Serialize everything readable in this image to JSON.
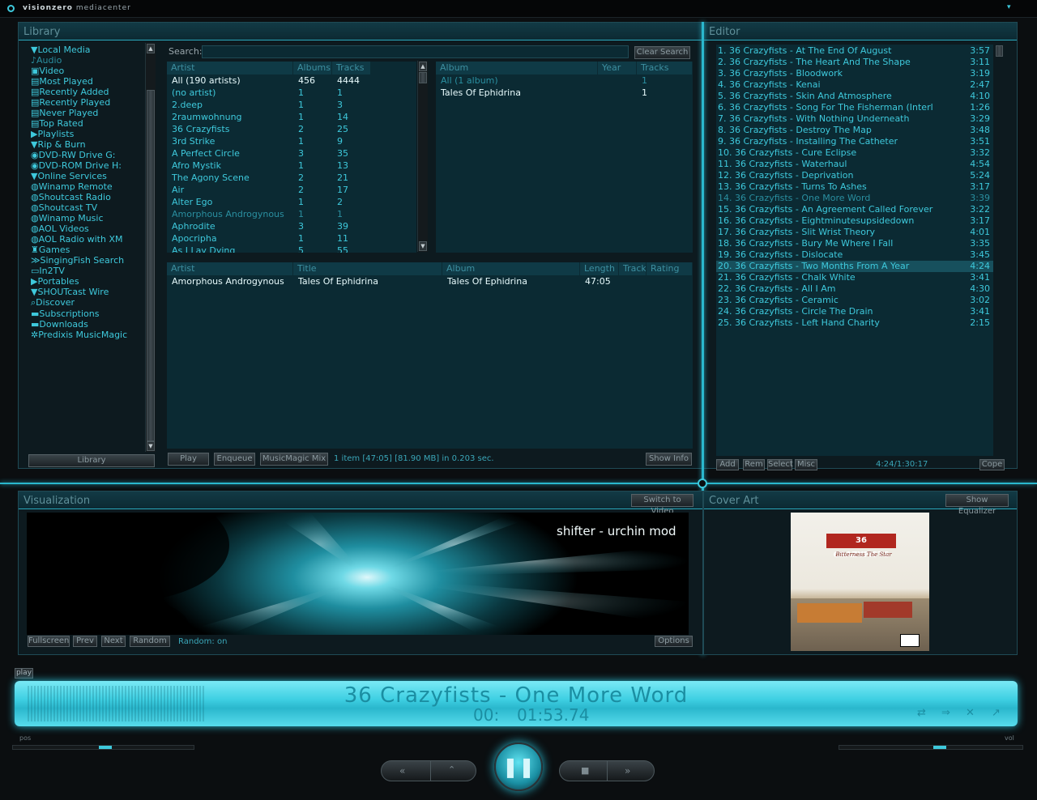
{
  "app": {
    "brand": "visionzero",
    "subtitle": "mediacenter"
  },
  "library": {
    "title": "Library",
    "tree": [
      {
        "label": "Local Media",
        "level": 0,
        "icon": "triangle-down-icon"
      },
      {
        "label": "Audio",
        "level": 1,
        "icon": "speaker-icon",
        "dim": true
      },
      {
        "label": "Video",
        "level": 1,
        "icon": "film-icon"
      },
      {
        "label": "Most Played",
        "level": 1,
        "icon": "list-icon"
      },
      {
        "label": "Recently Added",
        "level": 1,
        "icon": "list-icon"
      },
      {
        "label": "Recently Played",
        "level": 1,
        "icon": "list-icon"
      },
      {
        "label": "Never Played",
        "level": 1,
        "icon": "list-icon"
      },
      {
        "label": "Top Rated",
        "level": 1,
        "icon": "list-icon"
      },
      {
        "label": "Playlists",
        "level": 0,
        "icon": "triangle-right-icon"
      },
      {
        "label": "Rip & Burn",
        "level": 0,
        "icon": "triangle-down-icon"
      },
      {
        "label": "DVD-RW  Drive  G:",
        "level": 1,
        "icon": "disc-icon"
      },
      {
        "label": "DVD-ROM  Drive  H:",
        "level": 1,
        "icon": "disc-icon"
      },
      {
        "label": "Online Services",
        "level": 0,
        "icon": "triangle-down-icon"
      },
      {
        "label": "Winamp Remote",
        "level": 1,
        "icon": "globe-icon"
      },
      {
        "label": "Shoutcast Radio",
        "level": 1,
        "icon": "globe-icon"
      },
      {
        "label": "Shoutcast TV",
        "level": 1,
        "icon": "globe-icon"
      },
      {
        "label": "Winamp Music",
        "level": 1,
        "icon": "globe-icon"
      },
      {
        "label": "AOL Videos",
        "level": 1,
        "icon": "globe-icon"
      },
      {
        "label": "AOL Radio with XM",
        "level": 1,
        "icon": "globe-icon"
      },
      {
        "label": "Games",
        "level": 1,
        "icon": "joystick-icon"
      },
      {
        "label": "SingingFish Search",
        "level": 1,
        "icon": "fish-icon"
      },
      {
        "label": "In2TV",
        "level": 1,
        "icon": "tv-icon"
      },
      {
        "label": "Portables",
        "level": 0,
        "icon": "triangle-right-icon"
      },
      {
        "label": "SHOUTcast Wire",
        "level": 0,
        "icon": "triangle-down-icon"
      },
      {
        "label": "Discover",
        "level": 1,
        "icon": "search-icon"
      },
      {
        "label": "Subscriptions",
        "level": 1,
        "icon": "folder-icon"
      },
      {
        "label": "Downloads",
        "level": 1,
        "icon": "folder-icon"
      },
      {
        "label": "Predixis MusicMagic",
        "level": 0,
        "icon": "gear-icon"
      }
    ],
    "library_button": "Library",
    "search_label": "Search:",
    "search_value": "",
    "clear_search": "Clear Search",
    "artist_cols": [
      "Artist",
      "Albums",
      "Tracks"
    ],
    "artists": [
      [
        "All (190 artists)",
        "456",
        "4444"
      ],
      [
        "(no artist)",
        "1",
        "1"
      ],
      [
        "2.deep",
        "1",
        "3"
      ],
      [
        "2raumwohnung",
        "1",
        "14"
      ],
      [
        "36 Crazyfists",
        "2",
        "25"
      ],
      [
        "3rd Strike",
        "1",
        "9"
      ],
      [
        "A Perfect Circle",
        "3",
        "35"
      ],
      [
        "Afro Mystik",
        "1",
        "13"
      ],
      [
        "The Agony Scene",
        "2",
        "21"
      ],
      [
        "Air",
        "2",
        "17"
      ],
      [
        "Alter Ego",
        "1",
        "2"
      ],
      [
        "Amorphous Androgynous",
        "1",
        "1"
      ],
      [
        "Aphrodite",
        "3",
        "39"
      ],
      [
        "Apocripha",
        "1",
        "11"
      ],
      [
        "As I Lay Dying",
        "5",
        "55"
      ]
    ],
    "album_cols": [
      "Album",
      "Year",
      "Tracks"
    ],
    "albums": [
      [
        "All (1 album)",
        "",
        "1"
      ],
      [
        "Tales Of Ephidrina",
        "",
        "1"
      ]
    ],
    "track_cols": [
      "Artist",
      "Title",
      "Album",
      "Length",
      "Track",
      "Rating"
    ],
    "tracks": [
      [
        "Amorphous Androgynous",
        "Tales Of Ephidrina",
        "Tales Of Ephidrina",
        "47:05",
        "",
        ""
      ]
    ],
    "buttons": {
      "play": "Play",
      "enqueue": "Enqueue",
      "musicmagic": "MusicMagic Mix",
      "show_info": "Show Info"
    },
    "status": "1 item [47:05] [81.90 MB] in 0.203 sec."
  },
  "editor": {
    "title": "Editor",
    "items": [
      [
        "1. 36 Crazyfists - At The End Of August",
        "3:57"
      ],
      [
        "2. 36 Crazyfists - The Heart And The Shape",
        "3:11"
      ],
      [
        "3. 36 Crazyfists - Bloodwork",
        "3:19"
      ],
      [
        "4. 36 Crazyfists - Kenai",
        "2:47"
      ],
      [
        "5. 36 Crazyfists - Skin And Atmosphere",
        "4:10"
      ],
      [
        "6. 36 Crazyfists - Song For The Fisherman (Interl",
        "1:26"
      ],
      [
        "7. 36 Crazyfists - With Nothing Underneath",
        "3:29"
      ],
      [
        "8. 36 Crazyfists - Destroy The Map",
        "3:48"
      ],
      [
        "9. 36 Crazyfists - Installing The Catheter",
        "3:51"
      ],
      [
        "10. 36 Crazyfists - Cure Eclipse",
        "3:32"
      ],
      [
        "11. 36 Crazyfists - Waterhaul",
        "4:54"
      ],
      [
        "12. 36 Crazyfists - Deprivation",
        "5:24"
      ],
      [
        "13. 36 Crazyfists - Turns To Ashes",
        "3:17"
      ],
      [
        "14. 36 Crazyfists - One More Word",
        "3:39"
      ],
      [
        "15. 36 Crazyfists - An Agreement Called Forever",
        "3:22"
      ],
      [
        "16. 36 Crazyfists - Eightminutesupsidedown",
        "3:17"
      ],
      [
        "17. 36 Crazyfists - Slit Wrist Theory",
        "4:01"
      ],
      [
        "18. 36 Crazyfists - Bury Me Where I Fall",
        "3:35"
      ],
      [
        "19. 36 Crazyfists - Dislocate",
        "3:45"
      ],
      [
        "20. 36 Crazyfists - Two Months From A Year",
        "4:24"
      ],
      [
        "21. 36 Crazyfists - Chalk White",
        "3:41"
      ],
      [
        "22. 36 Crazyfists - All I Am",
        "4:30"
      ],
      [
        "23. 36 Crazyfists - Ceramic",
        "3:02"
      ],
      [
        "24. 36 Crazyfists - Circle The Drain",
        "3:41"
      ],
      [
        "25. 36 Crazyfists - Left Hand Charity",
        "2:15"
      ]
    ],
    "playing_index": 13,
    "selected_index": 19,
    "buttons": {
      "add": "Add",
      "rem": "Rem",
      "select": "Select",
      "misc": "Misc",
      "cope": "Cope"
    },
    "time": "4:24/1:30:17"
  },
  "visualization": {
    "title": "Visualization",
    "switch": "Switch to Video",
    "preset": "shifter - urchin mod",
    "buttons": {
      "fullscreen": "Fullscreen",
      "prev": "Prev",
      "next": "Next",
      "random": "Random",
      "options": "Options"
    },
    "random_status": "Random: on"
  },
  "cover": {
    "title": "Cover Art",
    "show_eq": "Show Equalizer",
    "band": "36 CRAZYFISTS",
    "album": "Bitterness The Star"
  },
  "player": {
    "state_tab": "play",
    "track": "36 Crazyfists - One More Word",
    "time_a": "00:",
    "time_b": "01:53.74",
    "pos_label": "pos",
    "vol_label": "vol",
    "position_fraction": 0.51,
    "volume_fraction": 0.55
  },
  "colors": {
    "accent": "#3ec9dc",
    "bg": "#0b2a33"
  }
}
